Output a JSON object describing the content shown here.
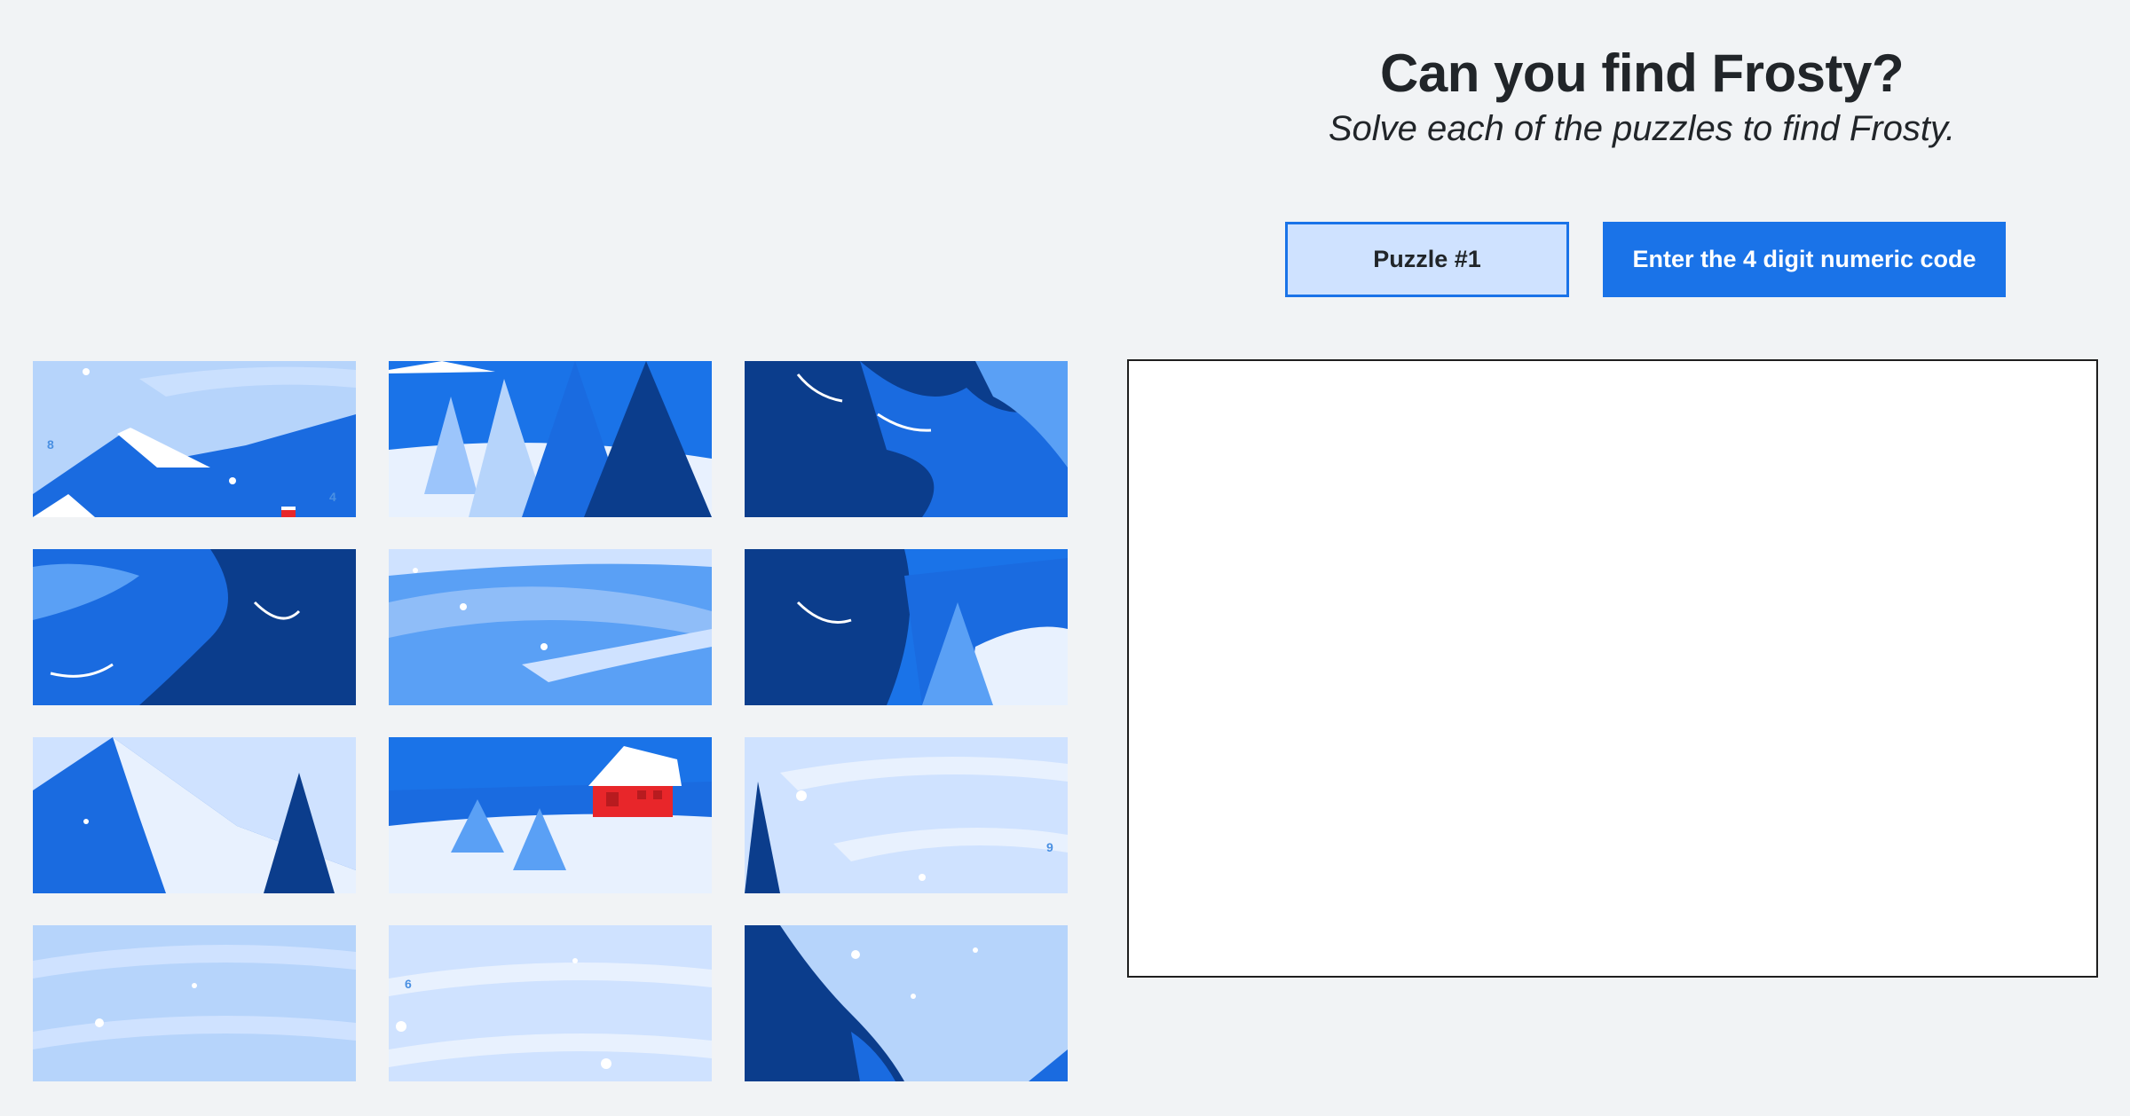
{
  "header": {
    "title": "Can you find Frosty?",
    "subtitle": "Solve each of the puzzles to find Frosty."
  },
  "buttons": {
    "puzzle_label": "Puzzle #1",
    "code_label": "Enter the 4 digit numeric code"
  },
  "tiles": {
    "t1_digit_a": "8",
    "t1_digit_b": "4",
    "t9_digit": "9",
    "t11_digit": "6"
  },
  "colors": {
    "background": "#f1f3f5",
    "accent": "#1a73e8",
    "accent_light": "#cfe2ff",
    "sky_light": "#b6d4fb",
    "tree_dark": "#0b3d8c",
    "tree_mid": "#1a6be0",
    "cabin_red": "#e8262a"
  }
}
